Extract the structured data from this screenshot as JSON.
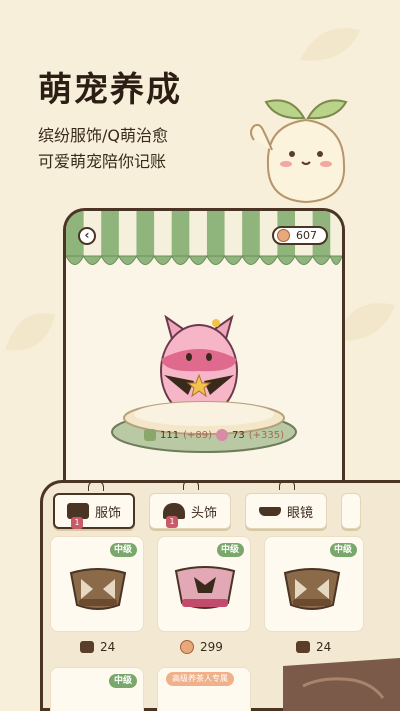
{
  "headline": "萌宠养成",
  "subtitle": {
    "line1": "缤纷服饰/Q萌治愈",
    "line2": "可爱萌宠陪你记账"
  },
  "top_bar": {
    "back_icon": "back-arrow-icon",
    "coin_count": "607"
  },
  "pet_stats": {
    "stat1_value": "111",
    "stat1_delta": "(+89)",
    "stat2_value": "73",
    "stat2_delta": "(+335)"
  },
  "tabs": [
    {
      "label": "服饰",
      "badge": "1",
      "icon": "clothing-icon"
    },
    {
      "label": "头饰",
      "badge": "1",
      "icon": "headwear-icon"
    },
    {
      "label": "眼镜",
      "badge": "",
      "icon": "glasses-icon"
    }
  ],
  "items": [
    {
      "level": "中级",
      "price": "24",
      "currency": "leaf"
    },
    {
      "level": "中级",
      "price": "299",
      "currency": "coin"
    },
    {
      "level": "中级",
      "price": "24",
      "currency": "leaf"
    }
  ],
  "row2": [
    {
      "level": "中级"
    },
    {
      "level": "高级养茶人专属"
    },
    {
      "level": ""
    }
  ],
  "colors": {
    "background": "#f7efd9",
    "awning_green": "#8fb47c",
    "outline": "#4a3424",
    "level_badge": "#7aa86c"
  }
}
